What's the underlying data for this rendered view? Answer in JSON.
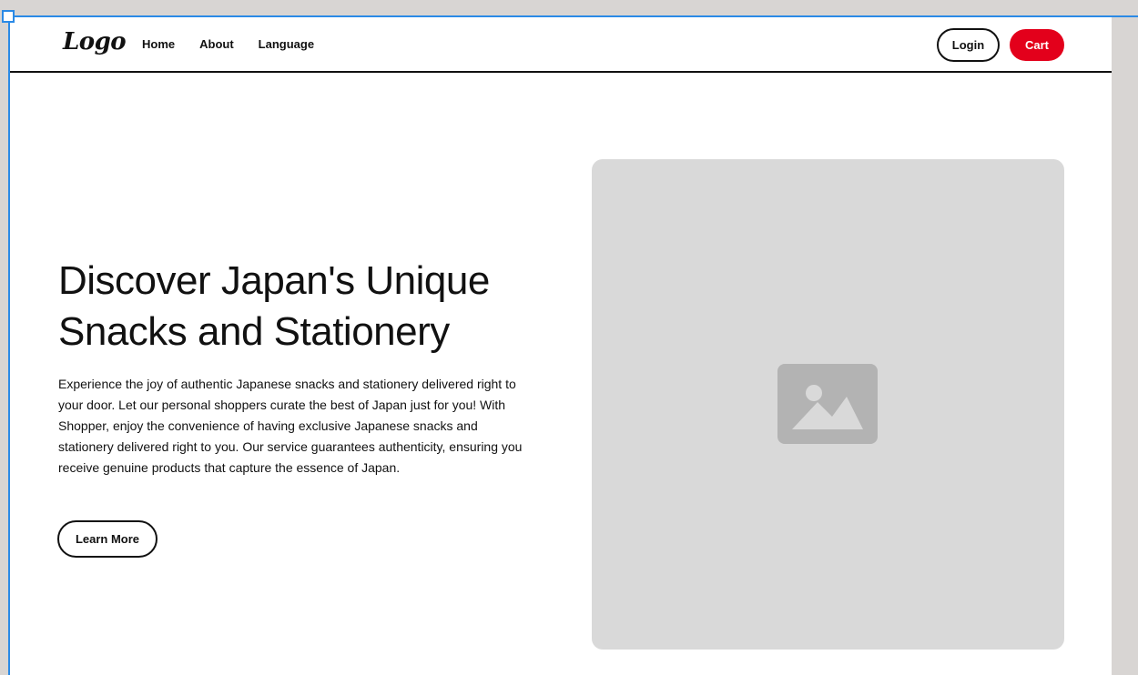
{
  "navbar": {
    "logo": "Logo",
    "links": [
      "Home",
      "About",
      "Language"
    ],
    "login_label": "Login",
    "cart_label": "Cart"
  },
  "hero": {
    "title_line1": "Discover Japan's Unique",
    "title_line2": "Snacks and Stationery",
    "description": "Experience the joy of authentic Japanese snacks and stationery delivered right to your door. Let our personal shoppers curate the best of Japan just for you! With Shopper, enjoy the convenience of having exclusive Japanese snacks and stationery delivered right to you. Our service guarantees authenticity, ensuring you receive genuine products that capture the essence of Japan.",
    "cta_label": "Learn More",
    "image_icon": "image-placeholder-icon"
  },
  "colors": {
    "accent": "#e3001b",
    "selection": "#2b8ae6",
    "placeholder": "#d9d9d9",
    "placeholder_icon": "#b3b3b3"
  }
}
